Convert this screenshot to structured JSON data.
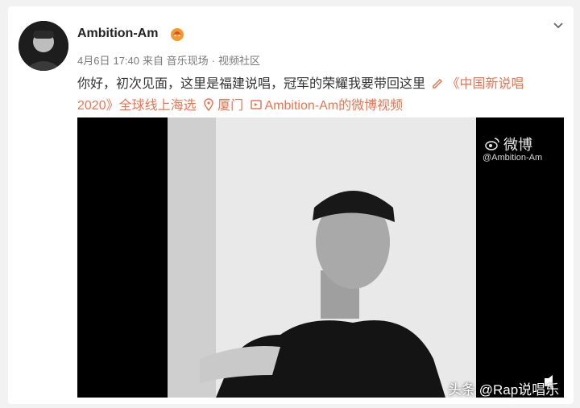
{
  "post": {
    "username": "Ambition-Am",
    "meta": {
      "date": "4月6日",
      "time": "17:40",
      "source": "来自 音乐现场",
      "separator": "·",
      "category": "视频社区"
    },
    "text": {
      "line1_body": "你好，初次见面，这里是福建说唱，冠军的荣耀我要带回这里",
      "topic": "《中国新说唱",
      "topic_line2": "2020》全球线上海选",
      "location": "厦门",
      "video_link": "Ambition-Am的微博视频"
    },
    "video": {
      "logo_text": "微博",
      "handle": "@Ambition-Am"
    }
  },
  "watermark": "头条 @Rap说唱乐",
  "colors": {
    "link": "#eb7350",
    "text": "#333333",
    "meta": "#7a7a7a",
    "background": "#f2f2f2"
  },
  "icons": {
    "badge": "fire-medal-icon",
    "chevron": "chevron-down-icon",
    "topic": "pencil-icon",
    "location": "location-pin-icon",
    "video": "video-icon",
    "weibo": "weibo-logo-icon",
    "play": "play-icon"
  }
}
